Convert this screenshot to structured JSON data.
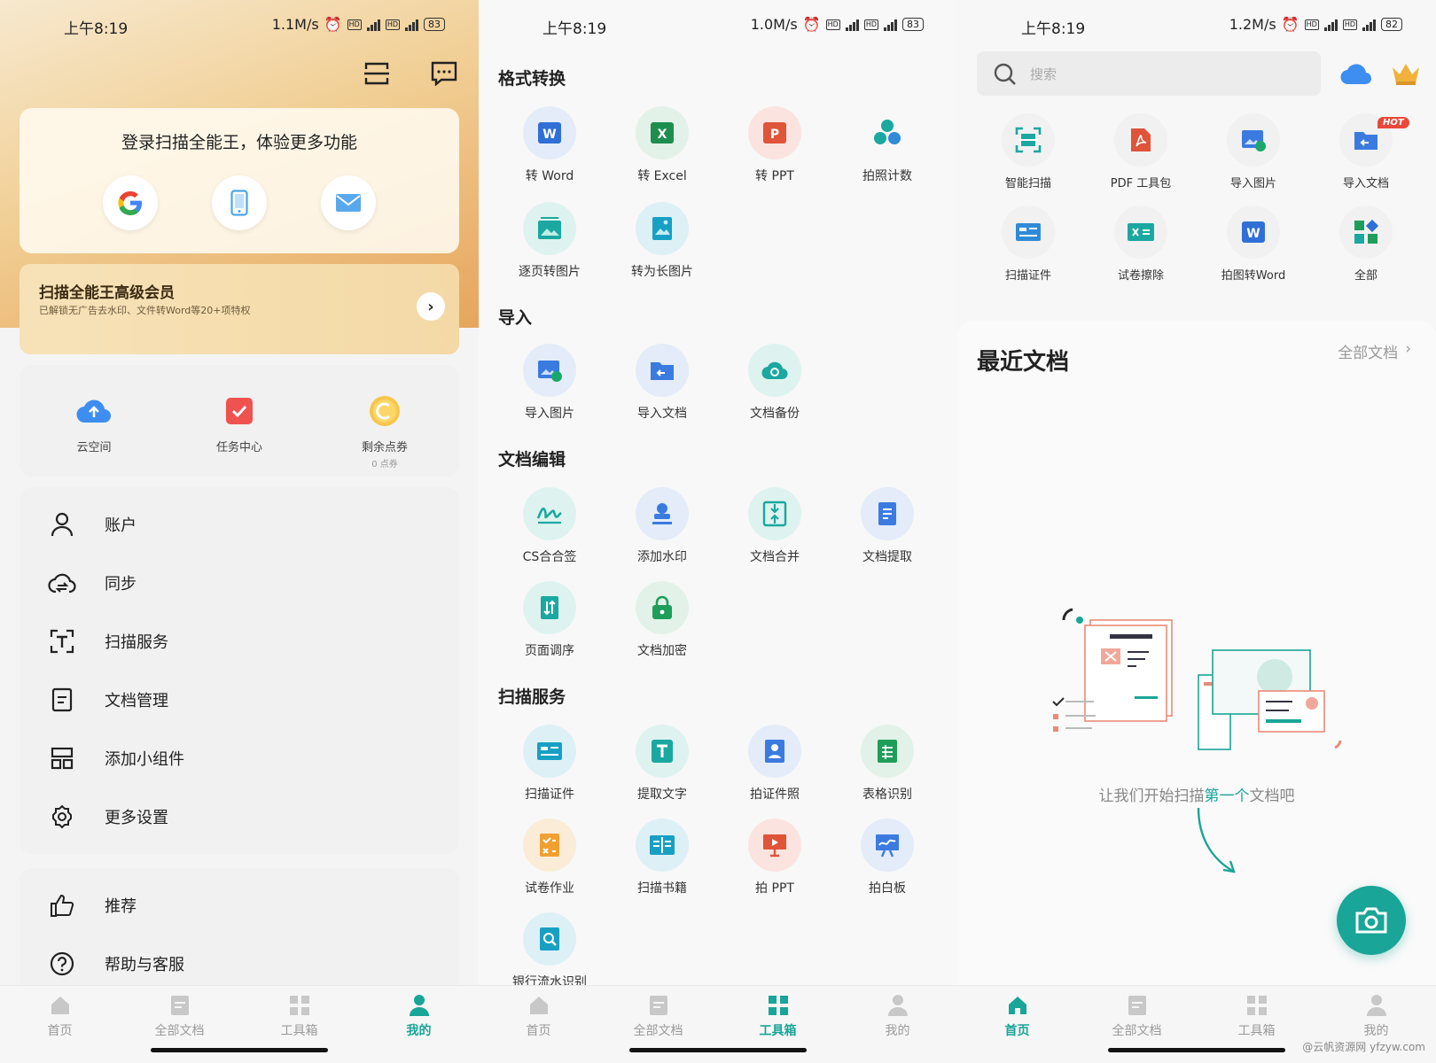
{
  "screen1": {
    "status": {
      "time": "上午8:19",
      "speed": "1.1M/s",
      "battery": "83"
    },
    "login": {
      "title": "登录扫描全能王，体验更多功能"
    },
    "vip": {
      "title": "扫描全能王高级会员",
      "subtitle": "已解锁无广告去水印、文件转Word等20+项特权"
    },
    "quick": [
      {
        "label": "云空间",
        "icon": "cloud-upload-icon"
      },
      {
        "label": "任务中心",
        "icon": "task-check-icon"
      },
      {
        "label": "剩余点券",
        "sub": "0 点券",
        "icon": "coupon-icon"
      }
    ],
    "menu": [
      "账户",
      "同步",
      "扫描服务",
      "文档管理",
      "添加小组件",
      "更多设置"
    ],
    "menu2": [
      "推荐",
      "帮助与客服"
    ]
  },
  "screen2": {
    "status": {
      "time": "上午8:19",
      "speed": "1.0M/s",
      "battery": "83"
    },
    "sections": {
      "convert": "格式转换",
      "import": "导入",
      "edit": "文档编辑",
      "scan": "扫描服务"
    },
    "convert": [
      "转 Word",
      "转 Excel",
      "转 PPT",
      "拍照计数",
      "逐页转图片",
      "转为长图片"
    ],
    "import": [
      "导入图片",
      "导入文档",
      "文档备份"
    ],
    "edit": [
      "CS合合签",
      "添加水印",
      "文档合并",
      "文档提取",
      "页面调序",
      "文档加密"
    ],
    "scan": [
      "扫描证件",
      "提取文字",
      "拍证件照",
      "表格识别",
      "试卷作业",
      "扫描书籍",
      "拍 PPT",
      "拍白板",
      "银行流水识别"
    ]
  },
  "screen3": {
    "status": {
      "time": "上午8:19",
      "speed": "1.2M/s",
      "battery": "82"
    },
    "search_placeholder": "搜索",
    "tools": [
      "智能扫描",
      "PDF 工具包",
      "导入图片",
      "导入文档",
      "扫描证件",
      "试卷擦除",
      "拍图转Word",
      "全部"
    ],
    "hot_badge": "HOT",
    "recent_title": "最近文档",
    "all_docs": "全部文档",
    "empty_pre": "让我们开始扫描",
    "empty_hl": "第一个",
    "empty_post": "文档吧"
  },
  "tabs": [
    "首页",
    "全部文档",
    "工具箱",
    "我的"
  ],
  "watermark": "@云帆资源网 yfzyw.com",
  "colors": {
    "accent": "#19a597",
    "gold": "#e8a94f"
  }
}
